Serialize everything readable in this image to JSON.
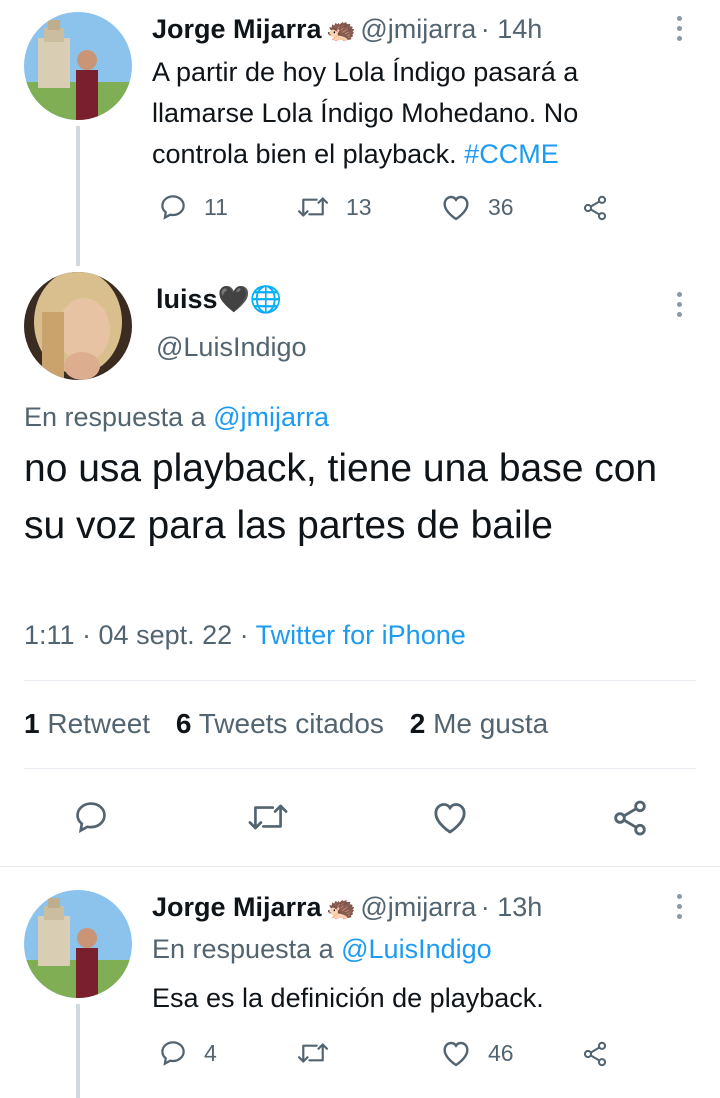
{
  "tweet1": {
    "name": "Jorge Mijarra",
    "emoji": "🦔",
    "handle": "@jmijarra",
    "time": "· 14h",
    "text_plain": "A partir de hoy Lola Índigo pasará a llamarse Lola Índigo Mohedano. No controla bien el playback. ",
    "hashtag": "#CCME",
    "replies": "11",
    "retweets": "13",
    "likes": "36"
  },
  "main": {
    "name": "luiss",
    "emoji": "🖤🌐",
    "handle": "@LuisIndigo",
    "reply_prefix": "En respuesta a ",
    "reply_to": "@jmijarra",
    "text": "no usa playback, tiene una base con su voz para las partes de baile",
    "time": "1:11 · 04 sept. 22 · ",
    "source": "Twitter for iPhone",
    "stats": {
      "retweets_count": "1",
      "retweets_label": "Retweet",
      "quotes_count": "6",
      "quotes_label": "Tweets citados",
      "likes_count": "2",
      "likes_label": "Me gusta"
    }
  },
  "tweet2": {
    "name": "Jorge Mijarra",
    "emoji": "🦔",
    "handle": "@jmijarra",
    "time": "· 13h",
    "reply_prefix": "En respuesta a ",
    "reply_to": "@LuisIndigo",
    "text": "Esa es la definición de playback.",
    "replies": "4",
    "retweets": "",
    "likes": "46"
  },
  "colors": {
    "link": "#1d9bf0",
    "muted": "#536471",
    "text": "#0f1419",
    "divider": "#e6ecf0"
  }
}
